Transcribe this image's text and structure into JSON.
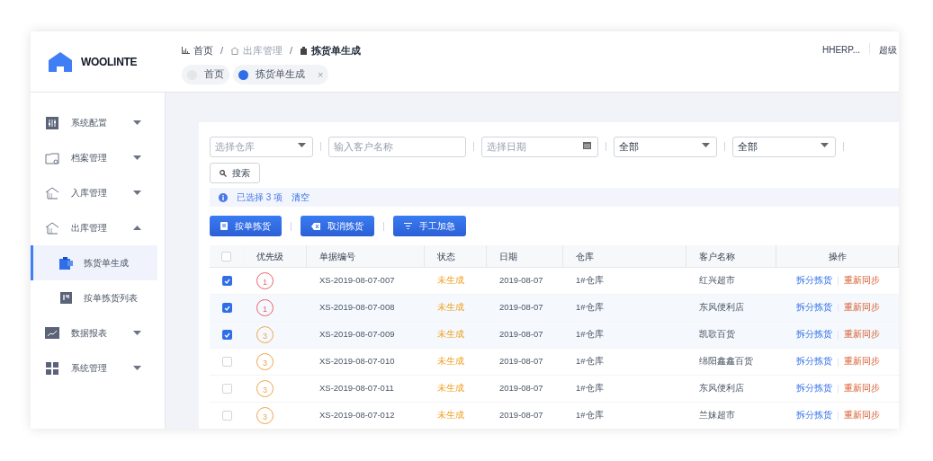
{
  "header": {
    "logo": "WOOLINTE",
    "breadcrumb": [
      "首页",
      "出库管理",
      "拣货单生成"
    ],
    "separator": "/",
    "tabs": [
      {
        "label": "首页",
        "selected": false,
        "closable": false
      },
      {
        "label": "拣货单生成",
        "selected": true,
        "closable": true
      }
    ],
    "close_mark": "×",
    "user": "HHERP...",
    "role": "超级"
  },
  "sidebar": {
    "items": [
      {
        "label": "系统配置",
        "expanded": false
      },
      {
        "label": "档案管理",
        "expanded": false
      },
      {
        "label": "入库管理",
        "expanded": false
      },
      {
        "label": "出库管理",
        "expanded": true,
        "children": [
          {
            "label": "拣货单生成",
            "selected": true
          },
          {
            "label": "按单拣货列表",
            "selected": false
          }
        ]
      },
      {
        "label": "数据报表",
        "expanded": false
      },
      {
        "label": "系统管理",
        "expanded": false
      }
    ]
  },
  "filters": [
    {
      "kind": "select",
      "placeholder": "选择仓库"
    },
    {
      "kind": "input",
      "placeholder": "输入客户名称"
    },
    {
      "kind": "date",
      "placeholder": "选择日期"
    },
    {
      "kind": "select",
      "value": "全部"
    },
    {
      "kind": "select",
      "value": "全部"
    }
  ],
  "search_button": "搜索",
  "selection_bar": {
    "text": "已选择 3 项",
    "clear": "清空"
  },
  "actions": [
    "按单拣货",
    "取消拣货",
    "手工加急"
  ],
  "table": {
    "columns": [
      "优先级",
      "单据编号",
      "状态",
      "日期",
      "仓库",
      "客户名称",
      "操作"
    ],
    "header_checked": false,
    "rows": [
      {
        "checked": true,
        "priority": {
          "text": "1",
          "color": "#e8646a"
        },
        "number": "XS-2019-08-07-007",
        "status": "未生成",
        "date": "2019-08-07",
        "warehouse": "1#仓库",
        "customer": "红兴超市",
        "ops": [
          "拆分拣货",
          "重新同步"
        ]
      },
      {
        "checked": true,
        "priority": {
          "text": "1",
          "color": "#e8646a"
        },
        "number": "XS-2019-08-07-008",
        "status": "未生成",
        "date": "2019-08-07",
        "warehouse": "1#仓库",
        "customer": "东风便利店",
        "ops": [
          "拆分拣货",
          "重新同步"
        ]
      },
      {
        "checked": true,
        "priority": {
          "text": "3",
          "color": "#f0a44b"
        },
        "number": "XS-2019-08-07-009",
        "status": "未生成",
        "date": "2019-08-07",
        "warehouse": "1#仓库",
        "customer": "凯歌百货",
        "ops": [
          "拆分拣货",
          "重新同步"
        ]
      },
      {
        "checked": false,
        "priority": {
          "text": "3",
          "color": "#f0a44b"
        },
        "number": "XS-2019-08-07-010",
        "status": "未生成",
        "date": "2019-08-07",
        "warehouse": "1#仓库",
        "customer": "绵阳鑫鑫百货",
        "ops": [
          "拆分拣货",
          "重新同步"
        ]
      },
      {
        "checked": false,
        "priority": {
          "text": "3",
          "color": "#f0a44b"
        },
        "number": "XS-2019-08-07-011",
        "status": "未生成",
        "date": "2019-08-07",
        "warehouse": "1#仓库",
        "customer": "东风便利店",
        "ops": [
          "拆分拣货",
          "重新同步"
        ]
      },
      {
        "checked": false,
        "priority": {
          "text": "3",
          "color": "#f0a44b"
        },
        "number": "XS-2019-08-07-012",
        "status": "未生成",
        "date": "2019-08-07",
        "warehouse": "1#仓库",
        "customer": "兰妹超市",
        "ops": [
          "拆分拣货",
          "重新同步"
        ]
      }
    ]
  }
}
